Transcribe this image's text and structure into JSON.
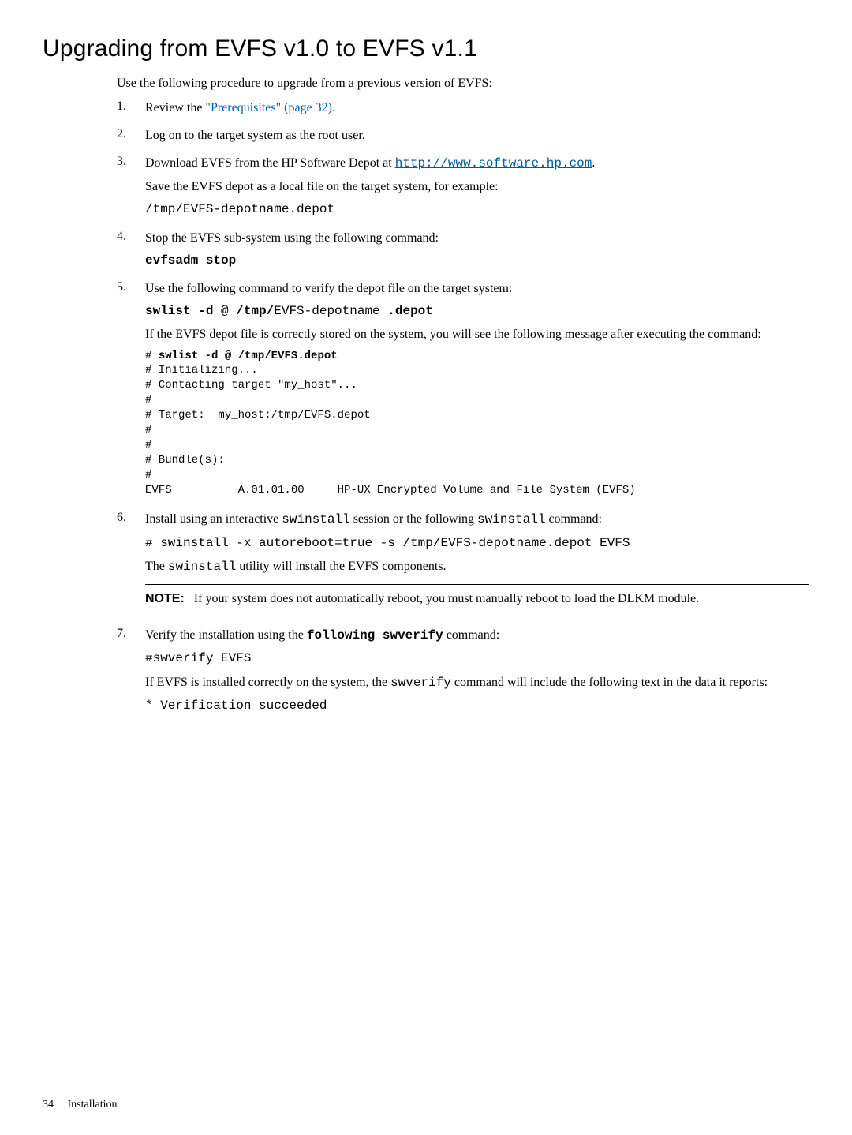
{
  "title": "Upgrading from EVFS v1.0 to EVFS v1.1",
  "intro": "Use the following procedure to upgrade from a previous version of EVFS:",
  "steps": {
    "s1": {
      "num": "1.",
      "pre": "Review the ",
      "link": "\"Prerequisites\" (page 32)",
      "post": "."
    },
    "s2": {
      "num": "2.",
      "text": "Log on to the target system as the root user."
    },
    "s3": {
      "num": "3.",
      "pre": "Download EVFS from the HP Software Depot at ",
      "link": "http://www.software.hp.com",
      "post": ".",
      "p2": "Save the EVFS depot as a local file on the target system, for example:",
      "p3": "/tmp/EVFS-depotname.depot"
    },
    "s4": {
      "num": "4.",
      "p1": "Stop the EVFS sub-system using the following command:",
      "p2": "evfsadm stop"
    },
    "s5": {
      "num": "5.",
      "p1": "Use the following command to verify the depot file on the target system:",
      "cmd_b1": "swlist -d @ /tmp/",
      "cmd_normal": "EVFS-depotname",
      "cmd_b2": " .depot",
      "p2": "If the EVFS depot file is correctly stored on the system, you will see the following message after executing the command:",
      "pre": "# swlist -d @ /tmp/EVFS.depot\n# Initializing...\n# Contacting target \"my_host\"...\n# \n# Target:  my_host:/tmp/EVFS.depot\n# \n# \n# Bundle(s):\n# \nEVFS          A.01.01.00     HP-UX Encrypted Volume and File System (EVFS)",
      "pre_first_bold": "swlist -d @ /tmp/EVFS.depot"
    },
    "s6": {
      "num": "6.",
      "p1_a": "Install using an interactive ",
      "p1_b": "swinstall",
      "p1_c": " session or the following ",
      "p1_d": "swinstall",
      "p1_e": " command:",
      "p2": "# swinstall -x autoreboot=true -s /tmp/EVFS-depotname.depot EVFS",
      "p3_a": "The ",
      "p3_b": "swinstall",
      "p3_c": " utility will install the EVFS components.",
      "note_label": "NOTE:",
      "note_text": "If your system does not automatically reboot, you must manually reboot to load the DLKM module."
    },
    "s7": {
      "num": "7.",
      "p1_a": "Verify the installation using the ",
      "p1_b": "following swverify",
      "p1_c": " command:",
      "p2": "#swverify EVFS",
      "p3_a": "If EVFS is installed correctly on the system, the ",
      "p3_b": "swverify",
      "p3_c": " command will include the following text in the data it reports:",
      "p4": "* Verification succeeded"
    }
  },
  "footer": {
    "page": "34",
    "section": "Installation"
  }
}
